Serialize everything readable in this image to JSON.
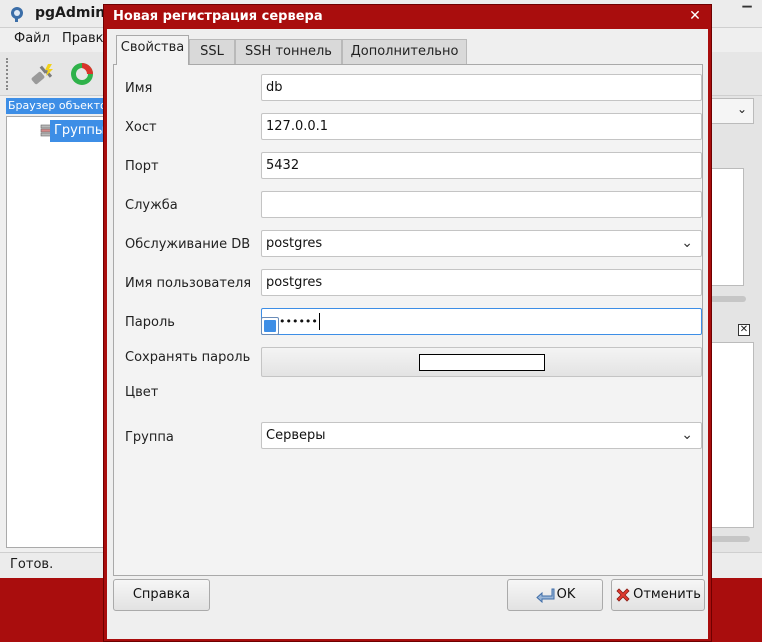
{
  "main_window": {
    "title": "pgAdmin I",
    "menu": [
      "Файл",
      "Правка"
    ],
    "browser_header": "Браузер объекто",
    "tree_item": "Группы",
    "status": "Готов."
  },
  "dialog": {
    "title": "Новая регистрация сервера",
    "tabs": [
      {
        "label": "Свойства"
      },
      {
        "label": "SSL"
      },
      {
        "label": "SSH тоннель"
      },
      {
        "label": "Дополнительно"
      }
    ],
    "fields": {
      "name": {
        "label": "Имя",
        "value": "db"
      },
      "host": {
        "label": "Хост",
        "value": "127.0.0.1"
      },
      "port": {
        "label": "Порт",
        "value": "5432"
      },
      "service": {
        "label": "Служба",
        "value": ""
      },
      "maintenance_db": {
        "label": "Обслуживание DB",
        "value": "postgres"
      },
      "username": {
        "label": "Имя пользователя",
        "value": "postgres"
      },
      "password": {
        "label": "Пароль",
        "value": "••••••••"
      },
      "save_password": {
        "label": "Сохранять пароль",
        "checked": true
      },
      "color": {
        "label": "Цвет",
        "value": "#ffffff"
      },
      "group": {
        "label": "Группа",
        "value": "Серверы"
      }
    },
    "buttons": {
      "help": "Справка",
      "ok": "OK",
      "cancel": "Отменить"
    }
  },
  "colors": {
    "desktop": "#a90d0d",
    "accent": "#3d8ee6"
  }
}
